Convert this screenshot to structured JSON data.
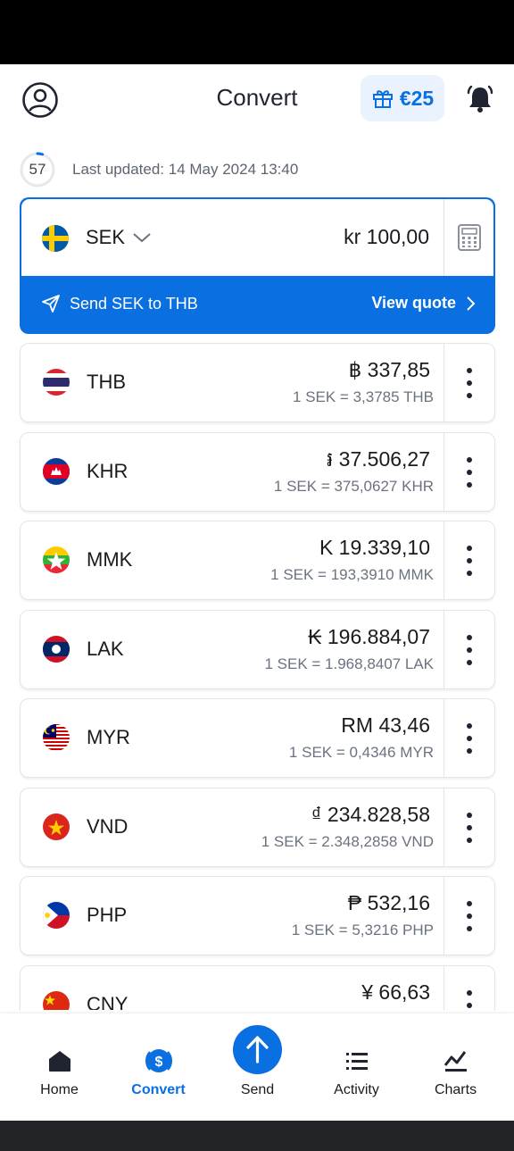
{
  "header": {
    "title": "Convert",
    "reward_amount": "€25",
    "icons": {
      "profile": "profile-icon",
      "gift": "gift-icon",
      "bell": "bell-icon"
    }
  },
  "update_info": {
    "countdown": "57",
    "countdown_progress": 0.05,
    "text": "Last updated: 14 May 2024 13:40"
  },
  "base": {
    "code": "SEK",
    "flag": "SE",
    "amount": "kr 100,00",
    "send_label": "Send SEK to THB",
    "view_quote_label": "View quote"
  },
  "currencies": [
    {
      "code": "THB",
      "flag": "TH",
      "amount": "฿ 337,85",
      "rate": "1 SEK = 3,3785 THB"
    },
    {
      "code": "KHR",
      "flag": "KH",
      "amount": "៛ 37.506,27",
      "rate": "1 SEK = 375,0627 KHR"
    },
    {
      "code": "MMK",
      "flag": "MM",
      "amount": "K 19.339,10",
      "rate": "1 SEK = 193,3910 MMK"
    },
    {
      "code": "LAK",
      "flag": "LA",
      "amount": "₭ 196.884,07",
      "rate": "1 SEK = 1.968,8407 LAK"
    },
    {
      "code": "MYR",
      "flag": "MY",
      "amount": "RM 43,46",
      "rate": "1 SEK = 0,4346 MYR"
    },
    {
      "code": "VND",
      "flag": "VN",
      "amount": "₫ 234.828,58",
      "rate": "1 SEK = 2.348,2858 VND"
    },
    {
      "code": "PHP",
      "flag": "PH",
      "amount": "₱ 532,16",
      "rate": "1 SEK = 5,3216 PHP"
    },
    {
      "code": "CNY",
      "flag": "CN",
      "amount": "¥ 66,63",
      "rate": ""
    }
  ],
  "nav": {
    "items": [
      {
        "label": "Home",
        "icon": "home-icon"
      },
      {
        "label": "Convert",
        "icon": "convert-icon",
        "active": true
      },
      {
        "label": "Send",
        "icon": "send-icon"
      },
      {
        "label": "Activity",
        "icon": "list-icon"
      },
      {
        "label": "Charts",
        "icon": "chart-icon"
      }
    ]
  },
  "colors": {
    "accent": "#0a6fe0",
    "text": "#1b1b1f",
    "muted": "#6b7280"
  }
}
